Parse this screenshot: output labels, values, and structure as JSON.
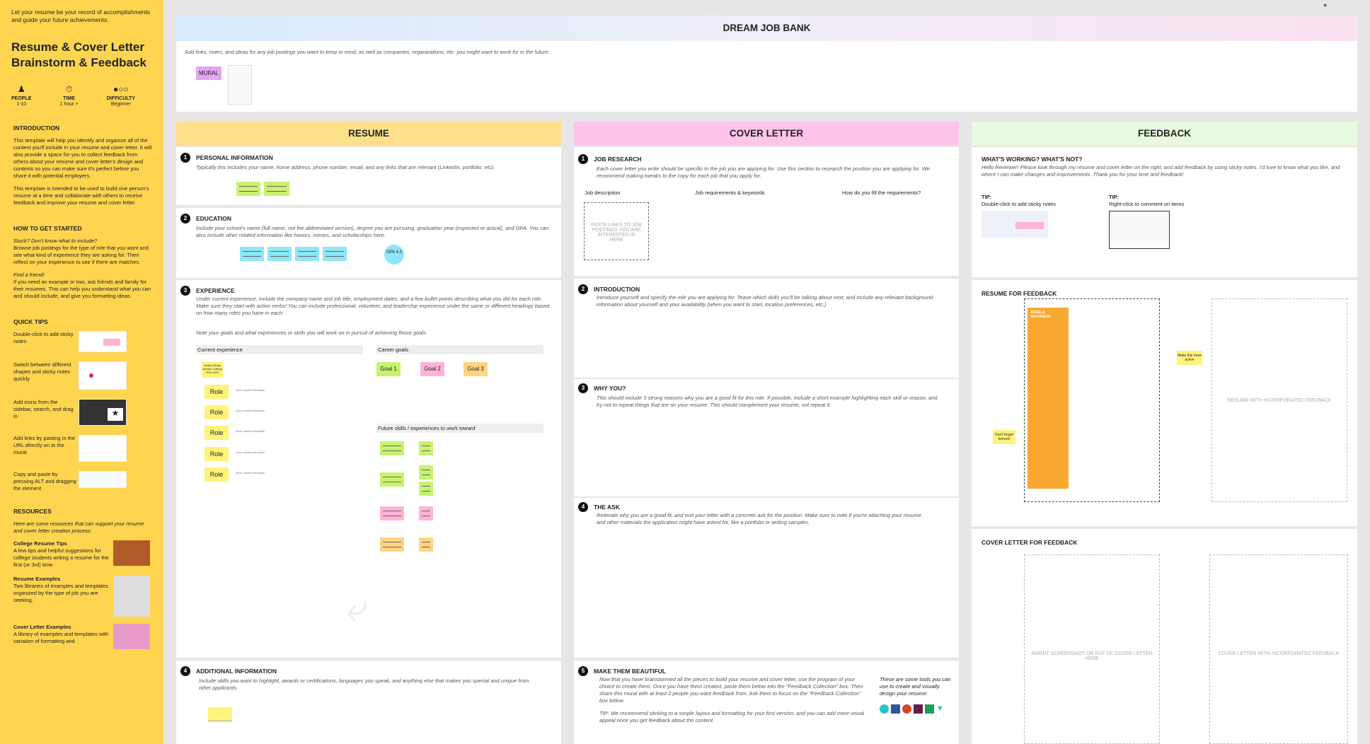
{
  "sidebar": {
    "intro": "Let your resume be your record of accomplishments and guide your future achievements.",
    "title": "Resume & Cover Letter Brainstorm & Feedback",
    "meta": {
      "people_label": "PEOPLE",
      "people_value": "1-10",
      "time_label": "TIME",
      "time_value": "1 hour +",
      "difficulty_label": "DIFFICULTY",
      "difficulty_value": "Beginner"
    },
    "intro_heading": "INTRODUCTION",
    "intro_p1": "This template will help you identify and organize all of the content you'll include in your resume and cover letter. It will also provide a space for you to collect feedback from others about your resume and cover letter's design and contents so you can make sure it's perfect before you share it with potential employers.",
    "intro_p2": "This template is intended to be used to build one person's resume at a time and collaborate with others to receive feedback and improve your resume and cover letter.",
    "how_heading": "HOW TO GET STARTED",
    "stuck_title": "Stuck? Don't know what to include?",
    "stuck_text": "Browse job postings for the type of role that you want and see what kind of experience they are asking for. Then reflect on your experience to see if there are matches.",
    "friend_title": "Find a friend!",
    "friend_text": "If you need an example or two, ask friends and family for their resumes. This can help you understand what you can and should include, and give you formatting ideas.",
    "tips_heading": "QUICK TIPS",
    "tips": [
      "Double-click to add sticky notes",
      "Switch between different shapes and sticky notes quickly",
      "Add icons from the sidebar, search, and drag in",
      "Add links by pasting in the URL directly on to the mural",
      "Copy and paste by pressing ALT and dragging the element"
    ],
    "resources_heading": "RESOURCES",
    "resources_intro": "Here are some resources that can support your resume and cover letter creation process:",
    "resources": [
      {
        "title": "College Resume Tips",
        "text": "A few tips and helpful suggestions for college students writing a resume for the first (or 3rd) time."
      },
      {
        "title": "Resume Examples",
        "text": "Two libraries of examples and templates organized by the type of job you are seeking."
      },
      {
        "title": "Cover Letter Examples",
        "text": "A library of examples and templates with variation of formatting and"
      }
    ]
  },
  "dream": {
    "title": "DREAM JOB BANK",
    "desc": "Add links, notes, and ideas for any job postings you want to keep in mind, as well as companies, organizations, etc. you might want to work for in the future.",
    "mural_tag": "MURAL"
  },
  "resume": {
    "title": "RESUME",
    "s1_title": "PERSONAL INFORMATION",
    "s1_desc": "Typically this includes your name, home address, phone number, email, and any links that are relevant (LinkedIn, portfolio, etc).",
    "s2_title": "EDUCATION",
    "s2_desc": "Include your school's name (full name, not the abbreviated version), degree you are pursuing, graduation year (expected or actual), and GPA. You can also include other related information like honors, minors, and scholarships here.",
    "gpa": "GPA 4.0",
    "s3_title": "EXPERIENCE",
    "s3_desc": "Under current experience, include the company name and job title, employment dates, and a few bullet points describing what you did for each role. Make sure they start with action verbs! You can include professional, volunteer, and leadership experience under the same or different headings based on how many roles you have in each.",
    "s3_note": "Note your goals and what experiences or skills you will work on in pursuit of achieving those goals.",
    "current_exp": "Current experience",
    "career_goals": "Career goals",
    "first_role": "Student Body Advisor College 2019-2020",
    "roles": [
      "Role",
      "Role",
      "Role",
      "Role",
      "Role"
    ],
    "role_desc": "Action oriented description",
    "goals": [
      "Goal 1",
      "Goal 2",
      "Goal 3"
    ],
    "future": "Future skills / experiences to work toward",
    "s4_title": "ADDITIONAL INFORMATION",
    "s4_desc": "Include skills you want to highlight, awards or certifications, languages you speak, and anything else that makes you special and unique from other applicants."
  },
  "cover": {
    "title": "COVER LETTER",
    "s1_title": "JOB RESEARCH",
    "s1_desc": "Each cover letter you write should be specific to the job you are applying for. Use this section to research the position you are applying for. We recommend making tweaks to the copy for each job that you apply for.",
    "col1": "Job description",
    "col2": "Job requirements & keywords",
    "col3": "How do you fill the requirements?",
    "paste": "PASTE LINKS TO JOB POSTINGS YOU ARE INTERESTED IN HERE",
    "s2_title": "INTRODUCTION",
    "s2_desc": "Introduce yourself and specify the role you are applying for. Tease which skills you'll be talking about next, and include any relevant background information about yourself and your availability (when you want to start, location preferences, etc.)",
    "s3_title": "WHY YOU?",
    "s3_desc": "This should include 3 strong reasons why you are a good fit for this role. If possible, include a short example highlighting each skill or reason, and try not to repeat things that are on your resume. This should complement your resume, not repeat it.",
    "s4_title": "THE ASK",
    "s4_desc": "Reiterate why you are a good fit, and end your letter with a concrete ask for the position. Make sure to note if you're attaching your resume and other materials the application might have asked for, like a portfolio or writing samples.",
    "s5_title": "MAKE THEM BEAUTIFUL",
    "s5_desc": "Now that you have brainstormed all the pieces to build your resume and cover letter, use the program of your choice to create them. Once you have them created, paste them below into the \"Feedback Collection\" box. Then share this mural with at least 2 people you want feedback from. Ask them to focus on the \"Feedback Collection\" box below.",
    "s5_tip": "TIP: We recommend sticking to a simple layout and formatting for your first version, and you can add more visual appeal once you get feedback about the content.",
    "tools": "These are some tools you can use to create and visually design your resume:"
  },
  "feedback": {
    "title": "FEEDBACK",
    "s1_title": "WHAT'S WORKING? WHAT'S NOT?",
    "s1_desc": "Hello Reviewer! Please look through my resume and cover letter on the right, and add feedback by using sticky notes. I'd love to know what you like, and where I can make changes and improvements. Thank you for your time and feedback!",
    "tip_label": "TIP:",
    "tip1": "Double-click to add sticky notes",
    "tip2": "Right-click to comment on items",
    "resume_heading": "RESUME FOR FEEDBACK",
    "resume_placeholder": "RESUME WITH INCORPORATED FEEDBACK",
    "resume_name": "ANGELA WILKINSON",
    "note1": "Make this more active",
    "note2": "Don't forget honors!",
    "cover_heading": "COVER LETTER FOR FEEDBACK",
    "cover_placeholder1": "INSERT SCREENSHOT OR PDF OF COVER LETTER HERE",
    "cover_placeholder2": "COVER LETTER WITH INCORPORATED FEEDBACK"
  },
  "colors": {
    "sidebar": "#ffd54f",
    "resume_head": "#ffe08a",
    "cover_head": "#ffc4ea",
    "feedback_head": "#e7f9de",
    "sticky_green": "#c8f26e",
    "sticky_blue": "#8ee6f7",
    "sticky_yellow": "#fff37a",
    "sticky_pink": "#ffb3d6",
    "sticky_orange": "#ffd580"
  }
}
